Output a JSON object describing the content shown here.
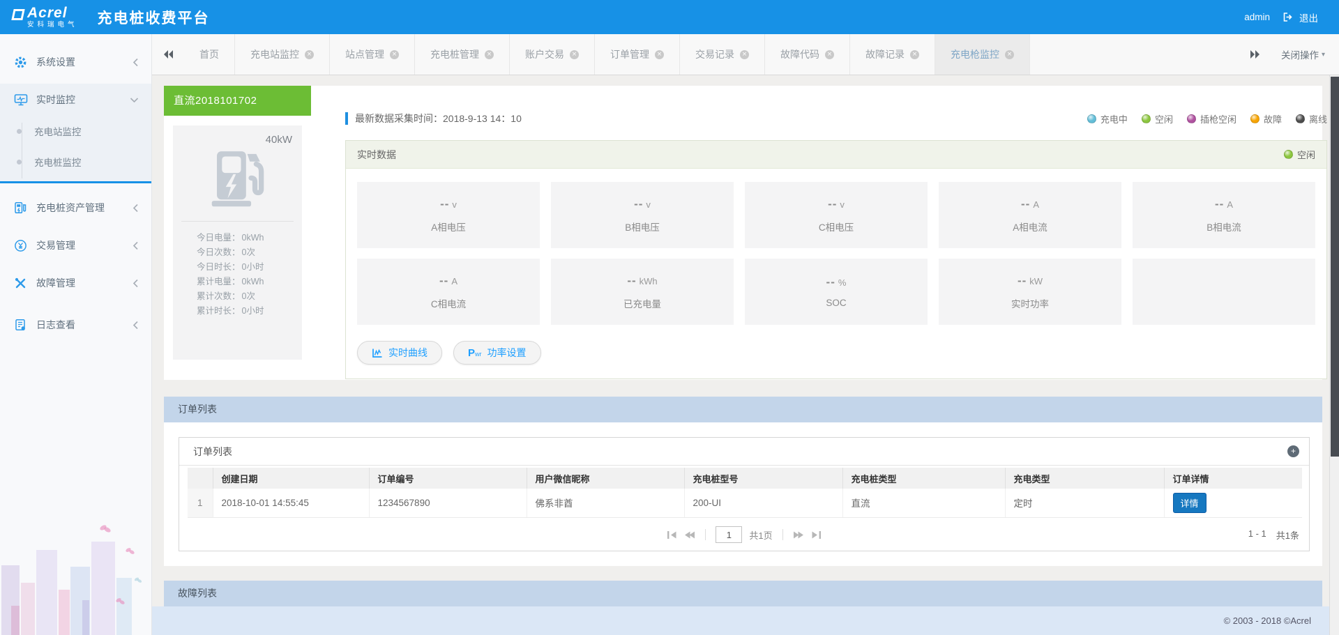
{
  "header": {
    "brand": "Acrel",
    "brand_sub": "安科瑞电气",
    "title": "充电桩收费平台",
    "user": "admin",
    "logout": "退出"
  },
  "tabbar": {
    "tabs": [
      {
        "label": "首页",
        "closable": false,
        "active": false
      },
      {
        "label": "充电站监控",
        "closable": true,
        "active": false
      },
      {
        "label": "站点管理",
        "closable": true,
        "active": false
      },
      {
        "label": "充电桩管理",
        "closable": true,
        "active": false
      },
      {
        "label": "账户交易",
        "closable": true,
        "active": false
      },
      {
        "label": "订单管理",
        "closable": true,
        "active": false
      },
      {
        "label": "交易记录",
        "closable": true,
        "active": false
      },
      {
        "label": "故障代码",
        "closable": true,
        "active": false
      },
      {
        "label": "故障记录",
        "closable": true,
        "active": false
      },
      {
        "label": "充电枪监控",
        "closable": true,
        "active": true
      }
    ],
    "close_ops": "关闭操作"
  },
  "sidebar": {
    "items": [
      {
        "icon": "gear-icon",
        "label": "系统设置"
      },
      {
        "icon": "monitor-icon",
        "label": "实时监控",
        "expanded": true,
        "children": [
          {
            "label": "充电站监控"
          },
          {
            "label": "充电桩监控"
          }
        ]
      },
      {
        "icon": "charging-pile-icon",
        "label": "充电桩资产管理"
      },
      {
        "icon": "transaction-icon",
        "label": "交易管理"
      },
      {
        "icon": "fault-icon",
        "label": "故障管理"
      },
      {
        "icon": "log-icon",
        "label": "日志查看"
      }
    ]
  },
  "device": {
    "name": "直流2018101702",
    "power": "40kW",
    "stats": [
      {
        "label": "今日电量：",
        "value": "0kWh"
      },
      {
        "label": "今日次数：",
        "value": "0次"
      },
      {
        "label": "今日时长：",
        "value": "0小时"
      },
      {
        "label": "累计电量：",
        "value": "0kWh"
      },
      {
        "label": "累计次数：",
        "value": "0次"
      },
      {
        "label": "累计时长：",
        "value": "0小时"
      }
    ]
  },
  "monitor": {
    "collect_time": "最新数据采集时间：2018-9-13 14：10",
    "legend": [
      {
        "label": "充电中",
        "color": "#63bed8"
      },
      {
        "label": "空闲",
        "color": "#8cc63e"
      },
      {
        "label": "插枪空闲",
        "color": "#b052a0"
      },
      {
        "label": "故障",
        "color": "#f7a400"
      },
      {
        "label": "离线",
        "color": "#4d4d4d"
      }
    ],
    "panel_title": "实时数据",
    "status_label": "空闲",
    "status_color": "#8cc63e",
    "metrics": [
      [
        {
          "value": "--",
          "unit": "v",
          "label": "A相电压"
        },
        {
          "value": "--",
          "unit": "v",
          "label": "B相电压"
        },
        {
          "value": "--",
          "unit": "v",
          "label": "C相电压"
        },
        {
          "value": "--",
          "unit": "A",
          "label": "A相电流"
        },
        {
          "value": "--",
          "unit": "A",
          "label": "B相电流"
        }
      ],
      [
        {
          "value": "--",
          "unit": "A",
          "label": "C相电流"
        },
        {
          "value": "--",
          "unit": "kWh",
          "label": "已充电量"
        },
        {
          "value": "--",
          "unit": "%",
          "label": "SOC"
        },
        {
          "value": "--",
          "unit": "kW",
          "label": "实时功率"
        },
        {
          "value": "",
          "unit": "",
          "label": ""
        }
      ]
    ],
    "buttons": [
      {
        "label": "实时曲线"
      },
      {
        "label": "功率设置"
      }
    ]
  },
  "orders": {
    "banner": "订单列表",
    "panel_title": "订单列表",
    "columns": [
      "创建日期",
      "订单编号",
      "用户微信昵称",
      "充电桩型号",
      "充电桩类型",
      "充电类型",
      "订单详情"
    ],
    "rows": [
      {
        "index": "1",
        "created": "2018-10-01 14:55:45",
        "order_no": "1234567890",
        "wechat": "佛系非酋",
        "pile_model": "200-UI",
        "pile_type": "直流",
        "charge_type": "定时",
        "detail": "详情"
      }
    ],
    "pagination": {
      "page": "1",
      "pages": "共1页",
      "range": "1 - 1",
      "total": "共1条"
    }
  },
  "faults": {
    "banner": "故障列表"
  },
  "footer": {
    "copyright": "© 2003 - 2018 ©Acrel"
  },
  "colors": {
    "header_blue": "#1791e6",
    "device_green": "#6cbd35",
    "banner_blue": "#c3d5ea",
    "accent_blue": "#1e9fff",
    "detail_button_blue": "#1678c0"
  }
}
